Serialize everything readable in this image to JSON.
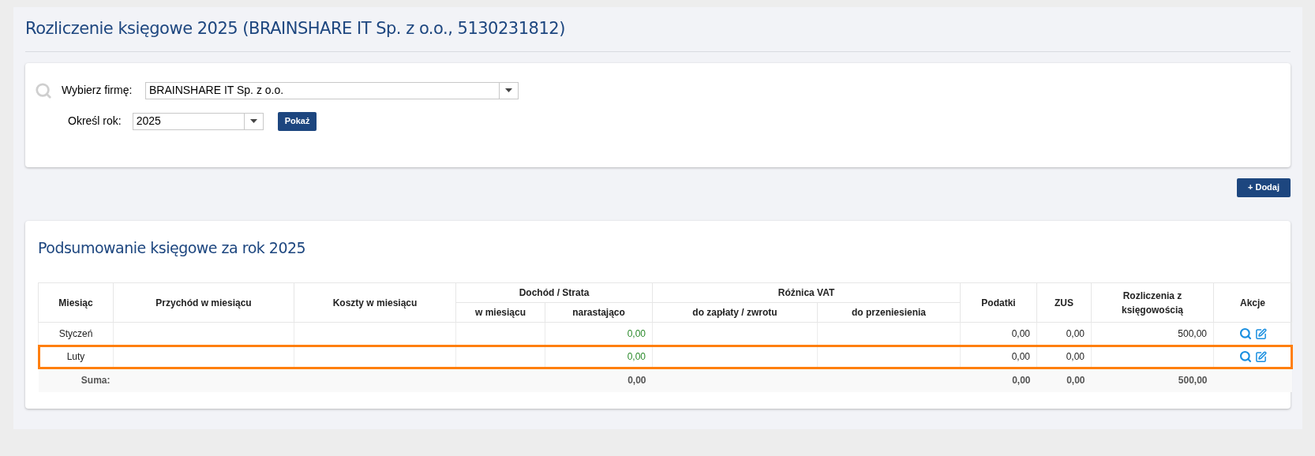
{
  "title": "Rozliczenie księgowe 2025 (BRAINSHARE IT Sp. z o.o., 5130231812)",
  "filter": {
    "company_label": "Wybierz firmę:",
    "company_value": "BRAINSHARE IT Sp. z o.o.",
    "year_label": "Określ rok:",
    "year_value": "2025",
    "show_button": "Pokaż"
  },
  "add_button": "+ Dodaj",
  "summary": {
    "title": "Podsumowanie księgowe za rok 2025",
    "header_groups": [
      {
        "label": "Miesiąc"
      },
      {
        "label": "Przychód w miesiącu"
      },
      {
        "label": "Koszty w miesiącu"
      },
      {
        "label": "Dochód / Strata",
        "sub": [
          "w miesiącu",
          "narastająco"
        ]
      },
      {
        "label": "Różnica VAT",
        "sub": [
          "do zapłaty / zwrotu",
          "do przeniesienia"
        ]
      },
      {
        "label": "Podatki"
      },
      {
        "label": "ZUS"
      },
      {
        "label": "Rozliczenia z księgowością"
      },
      {
        "label": "Akcje"
      }
    ],
    "rows": [
      {
        "month": "Styczeń",
        "cumulative": "0,00",
        "taxes": "0,00",
        "zus": "0,00",
        "settlements": "500,00",
        "highlighted": false
      },
      {
        "month": "Luty",
        "cumulative": "0,00",
        "taxes": "0,00",
        "zus": "0,00",
        "highlighted": true
      }
    ],
    "total": {
      "label": "Suma:",
      "cumulative": "0,00",
      "taxes": "0,00",
      "zus": "0,00",
      "settlements": "500,00"
    }
  }
}
